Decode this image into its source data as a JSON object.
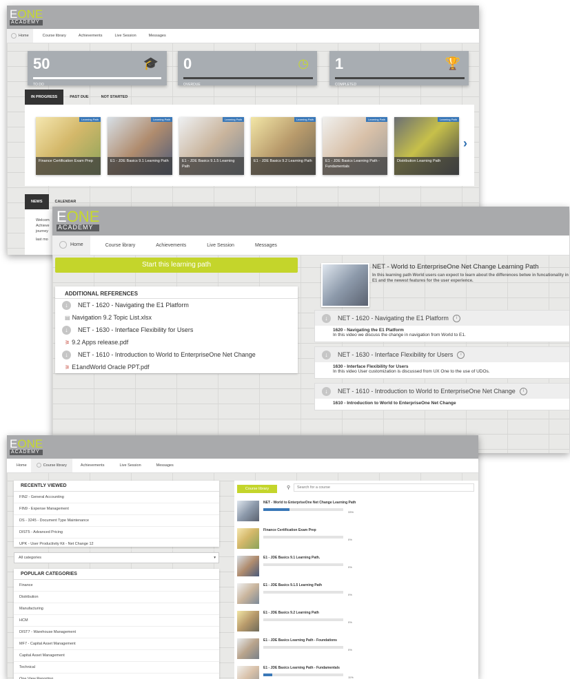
{
  "colors": {
    "accent": "#c6d92d",
    "brand_gray": "#a9aaac",
    "progress": "#3a78b8",
    "dark": "#333333"
  },
  "logo": {
    "e": "E",
    "one": "ONE",
    "academy": "ACADEMY"
  },
  "nav": {
    "home": "Home",
    "course_library": "Course library",
    "achievements": "Achievements",
    "live_session": "Live Session",
    "messages": "Messages"
  },
  "dashboard": {
    "stats": [
      {
        "value": "50",
        "label": "TO DO",
        "icon": "graduation-cap-icon"
      },
      {
        "value": "0",
        "label": "OVERDUE",
        "icon": "clock-icon"
      },
      {
        "value": "1",
        "label": "COMPLETED",
        "icon": "trophy-icon"
      }
    ],
    "tabs": [
      "IN PROGRESS",
      "PAST DUE",
      "NOT STARTED"
    ],
    "badge": "Learning Path",
    "tiles": [
      "Finance Certification Exam Prep",
      "E1 - JDE Basics 9.1 Learning Path",
      "E1 - JDE Basics 9.1.5 Learning Path",
      "E1 - JDE Basics 9.2 Learning Path",
      "E1 - JDE Basics Learning Path - Fundamentals",
      "Distribution Learning Path"
    ],
    "bottom_tabs": [
      "NEWS",
      "CALENDAR"
    ],
    "news_lines": [
      "Welcom",
      "Achieve",
      "journey",
      "last mo"
    ]
  },
  "learning_path": {
    "start_button": "Start this learning path",
    "refs_title": "ADDITIONAL REFERENCES",
    "refs": [
      {
        "text": "NET - 1620 - Navigating the E1 Platform",
        "kind": "module"
      },
      {
        "text": "Navigation 9.2 Topic List.xlsx",
        "kind": "xls"
      },
      {
        "text": "NET - 1630 - Interface Flexibility for Users",
        "kind": "module"
      },
      {
        "text": "9.2 Apps release.pdf",
        "kind": "pdf"
      },
      {
        "text": "NET - 1610 - Introduction to World to EnterpriseOne Net Change",
        "kind": "module"
      },
      {
        "text": "E1andWorld Oracle PPT.pdf",
        "kind": "pdf"
      }
    ],
    "title": "NET - World to EnterpriseOne Net Change Learning Path",
    "description": "In this learning path World users can expect to learn about the differences betwe in funcationality in E1 and the newest features for the user experience.",
    "sections": [
      {
        "title": "NET - 1620 - Navigating the E1 Platform",
        "item": "1620 - Navigating the E1 Platform",
        "desc": "In this video we discuss the change in navigation from World to E1."
      },
      {
        "title": "NET - 1630 - Interface Flexibility for Users",
        "item": "1630 - Interface Flexibility for Users",
        "desc": "In this video User customization is discussed from UX One to the use of UDOs."
      },
      {
        "title": "NET - 1610 - Introduction to World to EnterpriseOne Net Change",
        "item": "1610 - Introduction to World to EnterpriseOne Net Change",
        "desc": ""
      }
    ]
  },
  "library": {
    "recent_title": "RECENTLY VIEWED",
    "recent": [
      "FIN2 - General Accounting",
      "FIN9 - Expense Management",
      "DS - 3245 - Document Type Maintenance",
      "DIST5 - Advanced Pricing",
      "UPK - User Productivity Kit - Net Change 12"
    ],
    "category_select": "All categories",
    "popular_title": "POPULAR CATEGORIES",
    "popular": [
      "Finance",
      "Distribution",
      "Manufacturing",
      "HCM",
      "DIST7 - Warehouse Management",
      "MF7 - Capital Asset Management",
      "Capital Asset Management",
      "Technical",
      "One View Reporting"
    ],
    "tab": "Course library",
    "search_placeholder": "Search for a course",
    "courses": [
      {
        "name": "NET - World to EnterpriseOne Net Change Learning Path",
        "progress": 33,
        "pct": "33%"
      },
      {
        "name": "Finance Certification Exam Prep",
        "progress": 0,
        "pct": "0%"
      },
      {
        "name": "E1 - JDE Basics 9.1 Learning Path.",
        "progress": 0,
        "pct": "0%"
      },
      {
        "name": "E1 - JDE Basics 9.1.5 Learning Path",
        "progress": 0,
        "pct": "0%"
      },
      {
        "name": "E1 - JDE Basics 9.2 Learning Path",
        "progress": 0,
        "pct": "0%"
      },
      {
        "name": "E1 - JDE Basics Learning Path - Foundations",
        "progress": 0,
        "pct": "0%"
      },
      {
        "name": "E1 - JDE Basics Learning Path - Fundamentals",
        "progress": 11,
        "pct": "11%"
      }
    ]
  }
}
